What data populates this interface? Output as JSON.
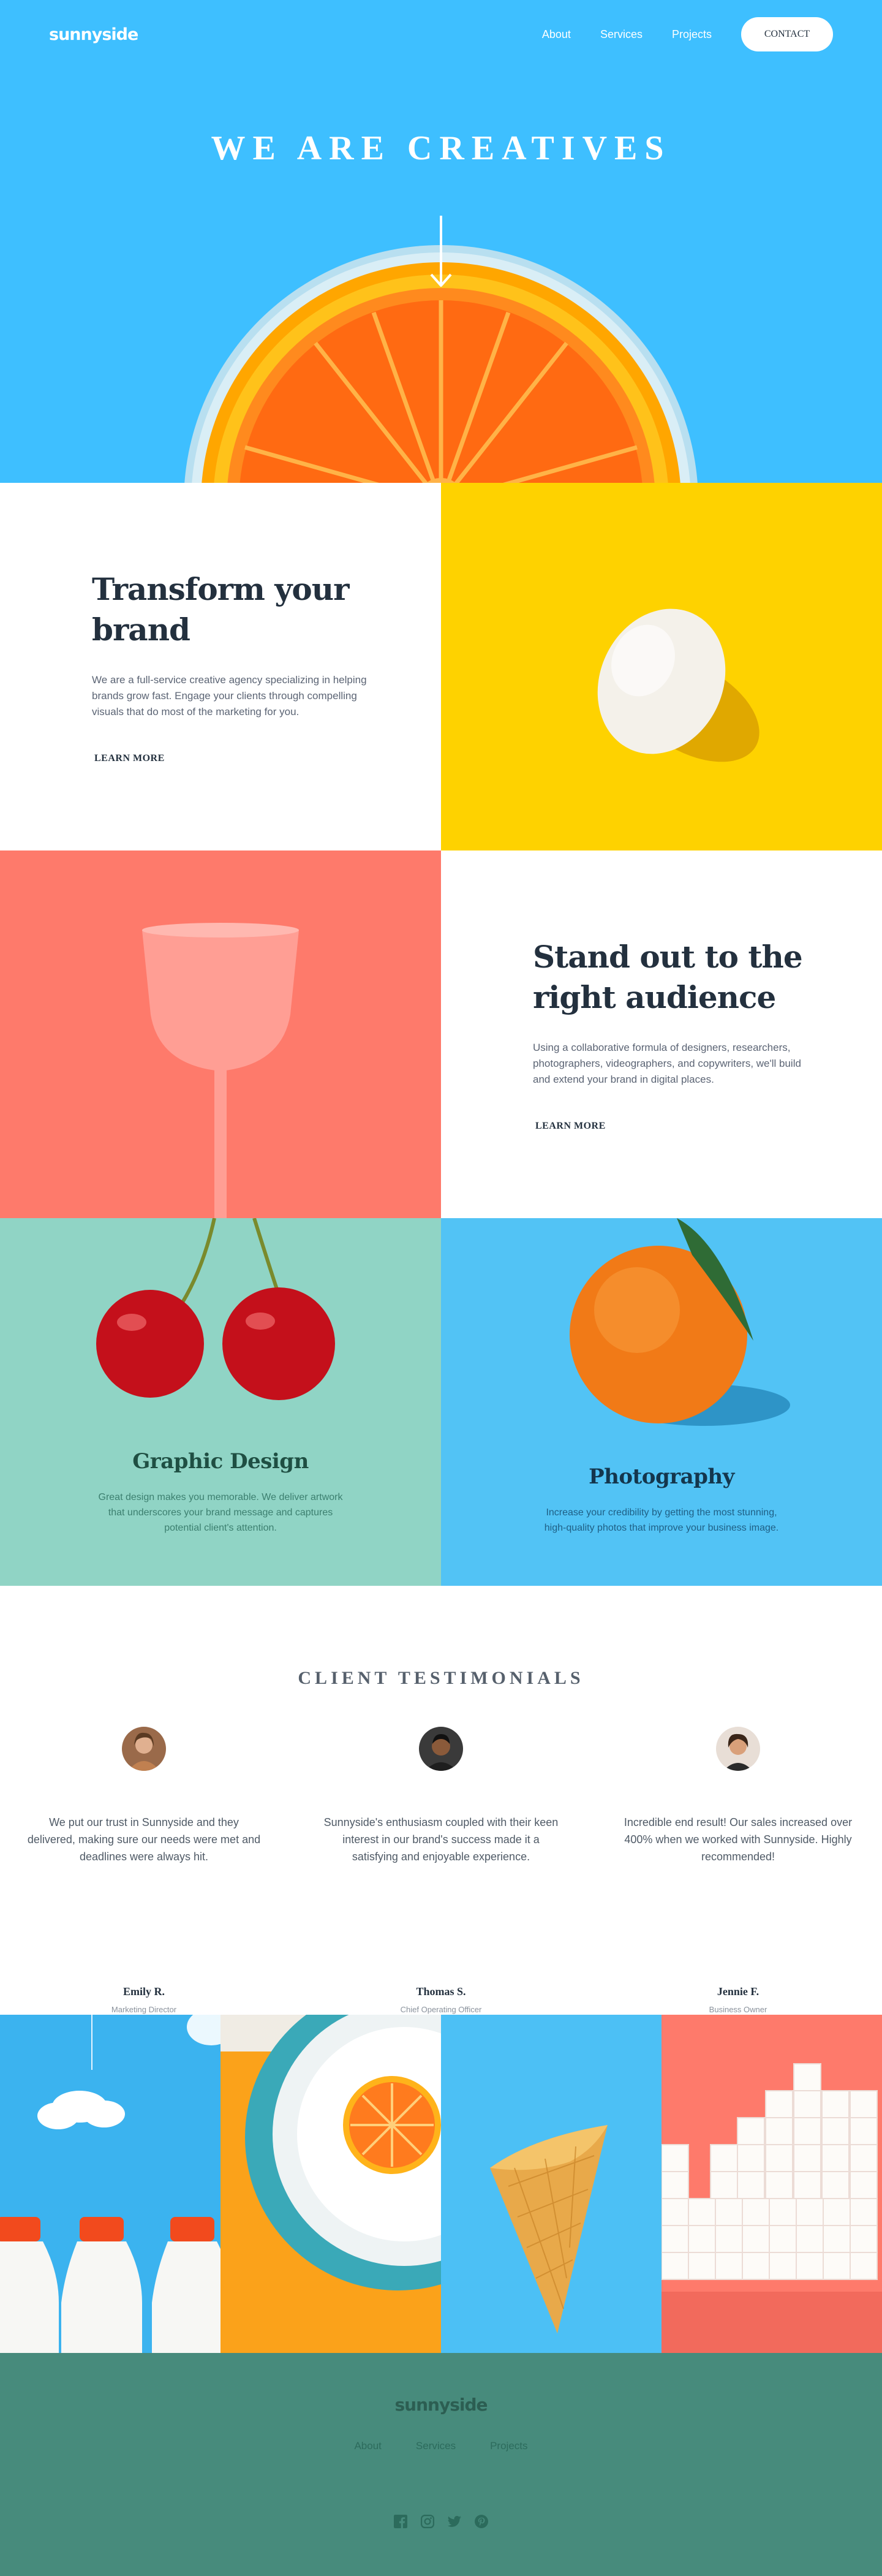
{
  "header": {
    "logo": "sunnyside",
    "nav": [
      {
        "label": "About"
      },
      {
        "label": "Services"
      },
      {
        "label": "Projects"
      }
    ],
    "contact_label": "CONTACT"
  },
  "hero": {
    "title": "WE ARE CREATIVES"
  },
  "transform": {
    "title": "Transform your brand",
    "body": "We are a full-service creative agency specializing in helping brands grow fast. Engage your clients through compelling visuals that do most of the marketing for you.",
    "cta": "LEARN MORE"
  },
  "standout": {
    "title": "Stand out to the right audience",
    "body": "Using a collaborative formula of designers, researchers, photographers, videographers, and copywriters, we'll build and extend your brand in digital places.",
    "cta": "LEARN MORE"
  },
  "services": [
    {
      "title": "Graphic Design",
      "body": "Great design makes you memorable. We deliver artwork that underscores your brand message and captures potential client's attention."
    },
    {
      "title": "Photography",
      "body": "Increase your credibility by getting the most stunning, high-quality photos that improve your business image."
    }
  ],
  "testimonials": {
    "heading": "CLIENT TESTIMONIALS",
    "items": [
      {
        "quote": "We put our trust in Sunnyside and they delivered, making sure our needs were met and deadlines were always hit.",
        "name": "Emily R.",
        "role": "Marketing Director"
      },
      {
        "quote": "Sunnyside's enthusiasm coupled with their keen interest in our brand's success made it a satisfying and enjoyable experience.",
        "name": "Thomas S.",
        "role": "Chief Operating Officer"
      },
      {
        "quote": "Incredible end result! Our sales increased over 400% when we worked with Sunnyside. Highly recommended!",
        "name": "Jennie F.",
        "role": "Business Owner"
      }
    ]
  },
  "footer": {
    "logo": "sunnyside",
    "links": [
      {
        "label": "About"
      },
      {
        "label": "Services"
      },
      {
        "label": "Projects"
      }
    ],
    "social_icons": [
      "facebook-icon",
      "instagram-icon",
      "twitter-icon",
      "pinterest-icon"
    ]
  },
  "colors": {
    "hero_blue": "#3ebfff",
    "yellow": "#fed200",
    "coral": "#fe7867",
    "mint": "#90d4c5",
    "footer_green": "#478b7c",
    "dark_text": "#23303e"
  }
}
